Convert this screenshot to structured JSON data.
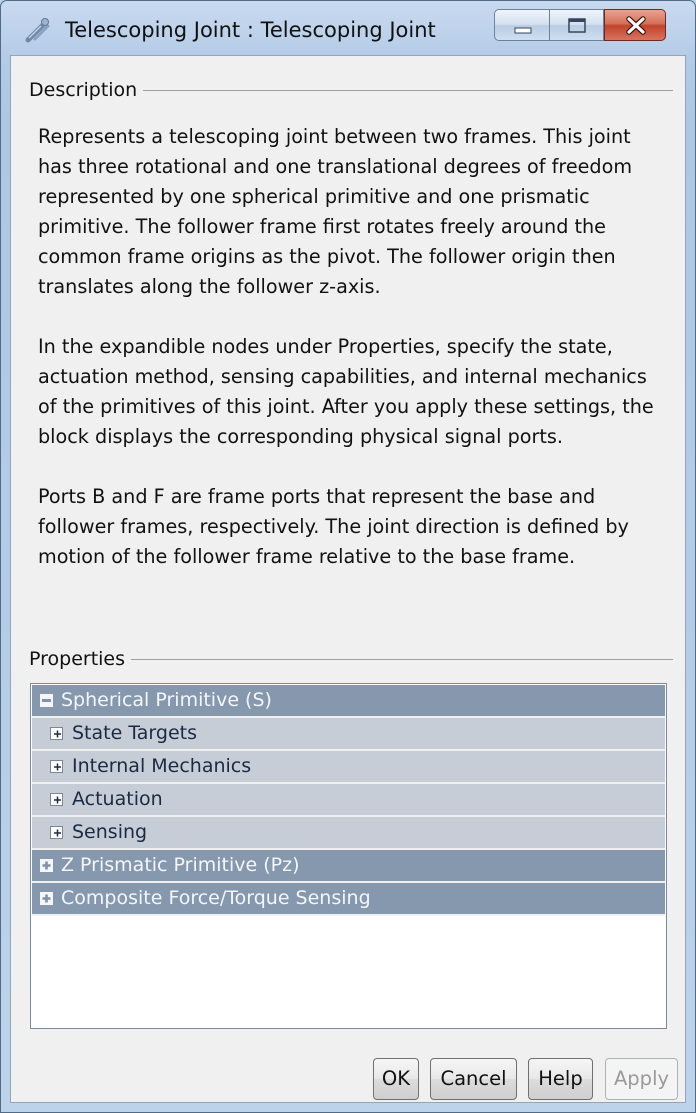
{
  "window": {
    "title": "Telescoping Joint : Telescoping Joint",
    "icon": "joint-block-icon",
    "controls": [
      "minimize-icon",
      "maximize-icon",
      "close-icon"
    ]
  },
  "description": {
    "label": "Description",
    "paragraphs": [
      "Represents a telescoping joint between two frames. This joint has three rotational and one translational degrees of freedom represented by one spherical primitive and one prismatic primitive. The follower frame first rotates freely around the common frame origins as the pivot. The follower origin then translates along the follower z-axis.",
      "In the expandible nodes under Properties, specify the state, actuation method, sensing capabilities, and internal mechanics of the primitives of this joint. After you apply these settings, the block displays the corresponding physical signal ports.",
      "Ports B and F are frame ports that represent the base and follower frames, respectively. The joint direction is defined by motion of the follower frame relative to the base frame."
    ]
  },
  "properties": {
    "label": "Properties",
    "tree": [
      {
        "label": "Spherical Primitive (S)",
        "expanded": true
      },
      {
        "label": "State Targets",
        "expanded": false
      },
      {
        "label": "Internal Mechanics",
        "expanded": false
      },
      {
        "label": "Actuation",
        "expanded": false
      },
      {
        "label": "Sensing",
        "expanded": false
      },
      {
        "label": "Z Prismatic Primitive (Pz)",
        "expanded": false
      },
      {
        "label": "Composite Force/Torque Sensing",
        "expanded": false
      }
    ]
  },
  "buttons": {
    "ok": "OK",
    "cancel": "Cancel",
    "help": "Help",
    "apply": "Apply",
    "apply_enabled": false
  },
  "colors": {
    "tree_header_bg": "#8598ae",
    "tree_child_bg": "#c6cdd6",
    "close_button": "#c7513b"
  }
}
